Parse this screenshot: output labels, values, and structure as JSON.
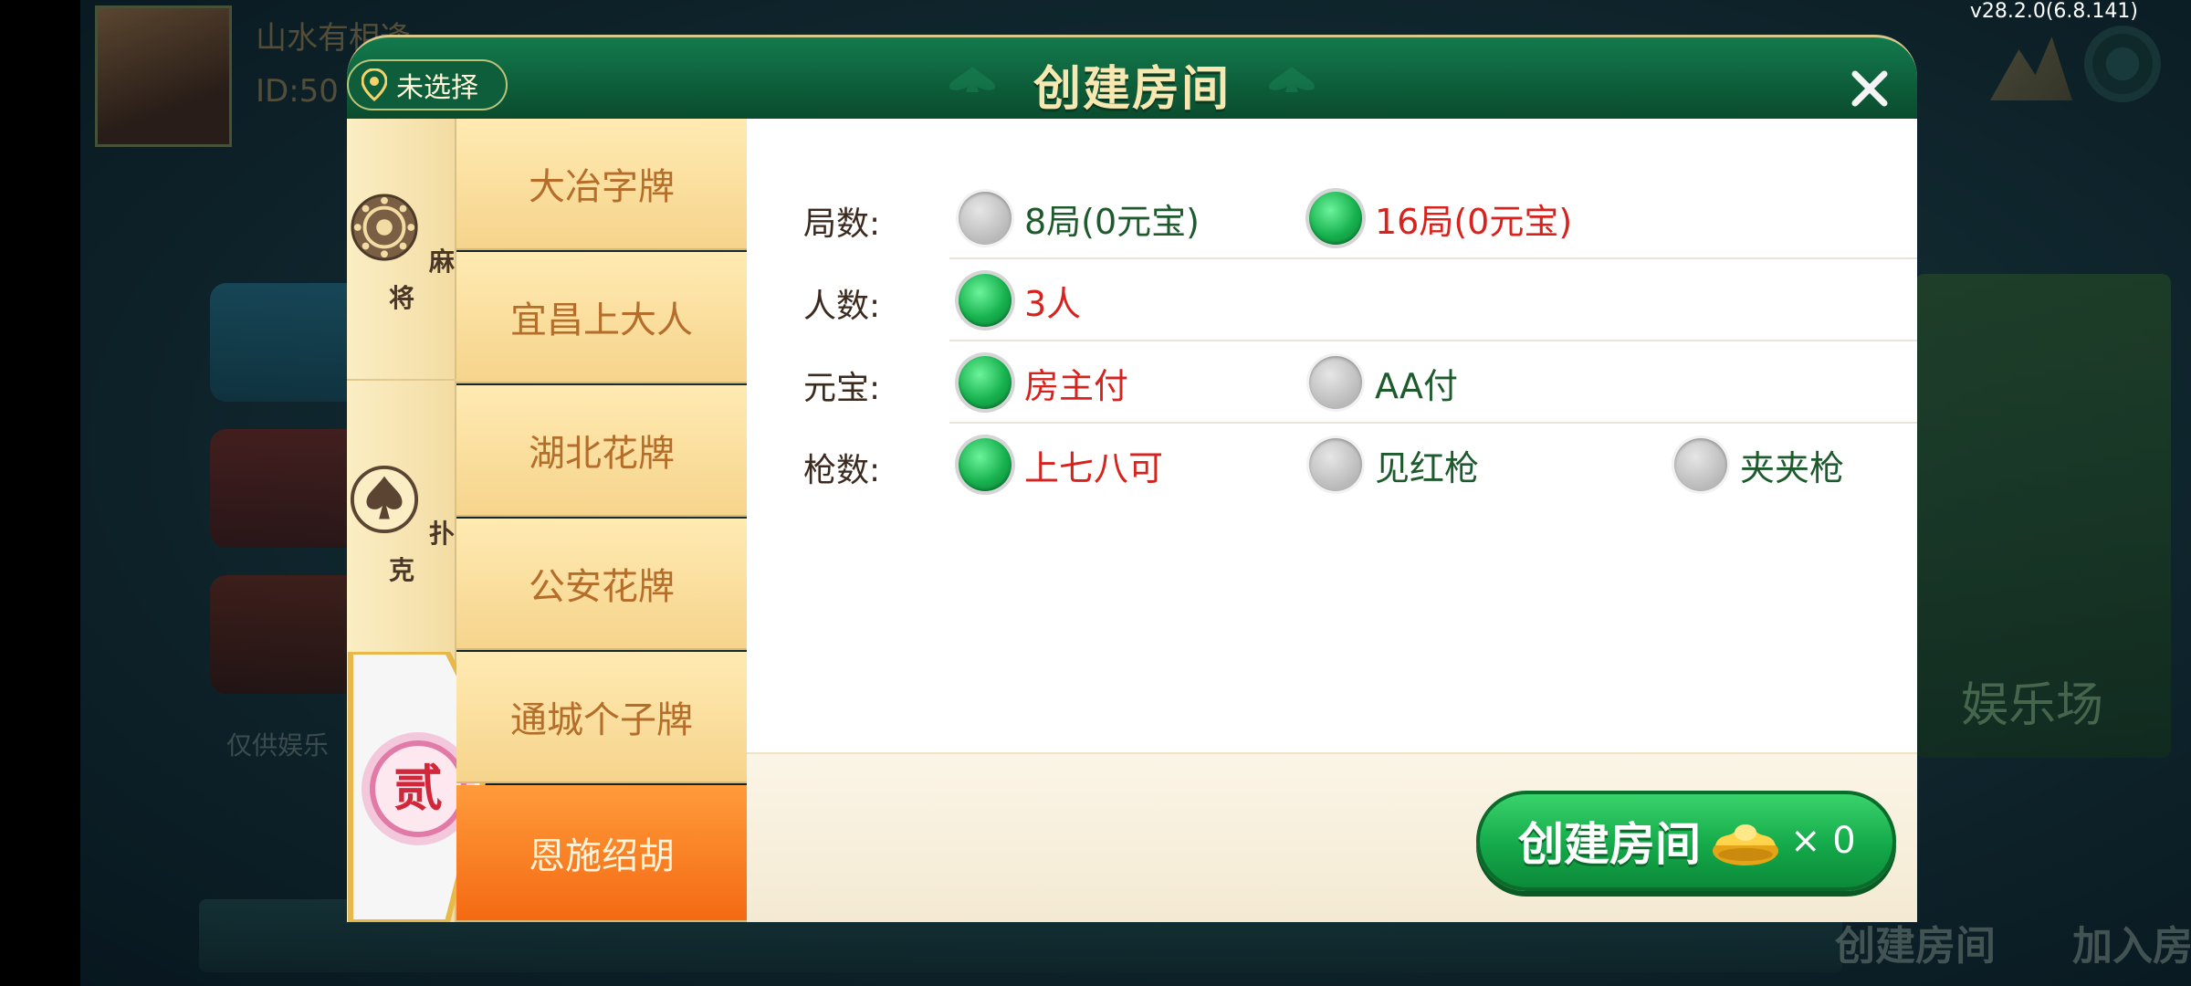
{
  "version": "v28.2.0(6.8.141)",
  "background": {
    "player_name": "山水有相逢",
    "player_id": "ID:50",
    "side_text": "仅供娱乐",
    "right_card_text": "娱乐场",
    "bottom_create": "创建房间",
    "bottom_join": "加入房间"
  },
  "dialog": {
    "title": "创建房间",
    "location_label": "未选择",
    "categories": [
      {
        "label": "麻将",
        "icon": "mahjong-icon"
      },
      {
        "label": "扑克",
        "icon": "spade-icon"
      },
      {
        "label": "贰",
        "icon": "er-chip-icon"
      }
    ],
    "games": [
      {
        "label": "大冶字牌",
        "active": false
      },
      {
        "label": "宜昌上大人",
        "active": false
      },
      {
        "label": "湖北花牌",
        "active": false
      },
      {
        "label": "公安花牌",
        "active": false
      },
      {
        "label": "通城个子牌",
        "active": false
      },
      {
        "label": "恩施绍胡",
        "active": true
      }
    ],
    "options": {
      "rounds": {
        "label": "局数:",
        "choices": [
          {
            "text": "8局(0元宝)",
            "selected": false
          },
          {
            "text": "16局(0元宝)",
            "selected": true
          }
        ]
      },
      "players": {
        "label": "人数:",
        "choices": [
          {
            "text": "3人",
            "selected": true
          }
        ]
      },
      "payment": {
        "label": "元宝:",
        "choices": [
          {
            "text": "房主付",
            "selected": true
          },
          {
            "text": "AA付",
            "selected": false
          }
        ]
      },
      "guns": {
        "label": "枪数:",
        "choices": [
          {
            "text": "上七八可",
            "selected": true
          },
          {
            "text": "见红枪",
            "selected": false
          },
          {
            "text": "夹夹枪",
            "selected": false
          }
        ]
      }
    },
    "create_button": {
      "label": "创建房间",
      "cost": "× 0"
    }
  },
  "colors": {
    "title_green": "#0d5e3a",
    "selected_text": "#d7221d",
    "unselected_text": "#1d5a2c",
    "active_tab": "#f46a13",
    "button_green": "#14a94a"
  }
}
